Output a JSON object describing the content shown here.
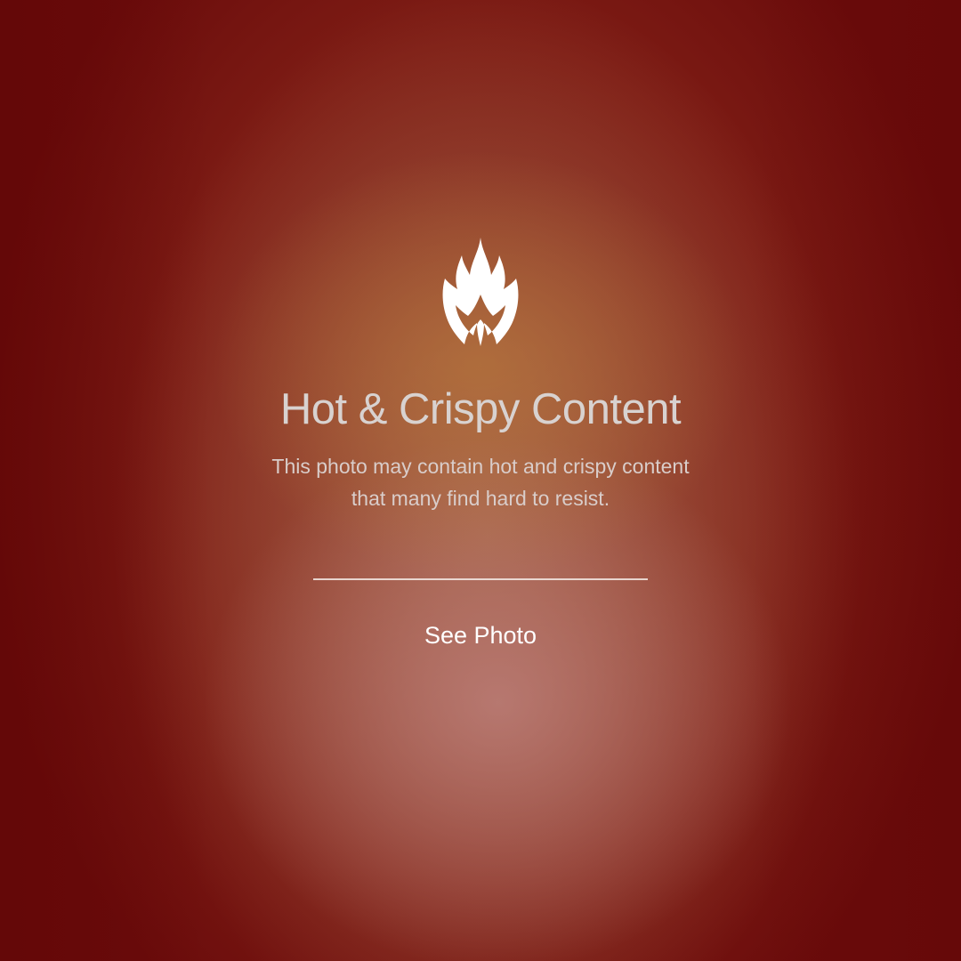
{
  "warning": {
    "icon": "fire-icon",
    "title": "Hot & Crispy Content",
    "description": "This photo may contain hot and crispy content that many find hard to resist.",
    "action_label": "See Photo"
  },
  "colors": {
    "text_primary": "#ffffff",
    "text_muted": "#d8d2d0",
    "background_edge": "#6a0b0b",
    "background_glow": "#b07a6e"
  }
}
